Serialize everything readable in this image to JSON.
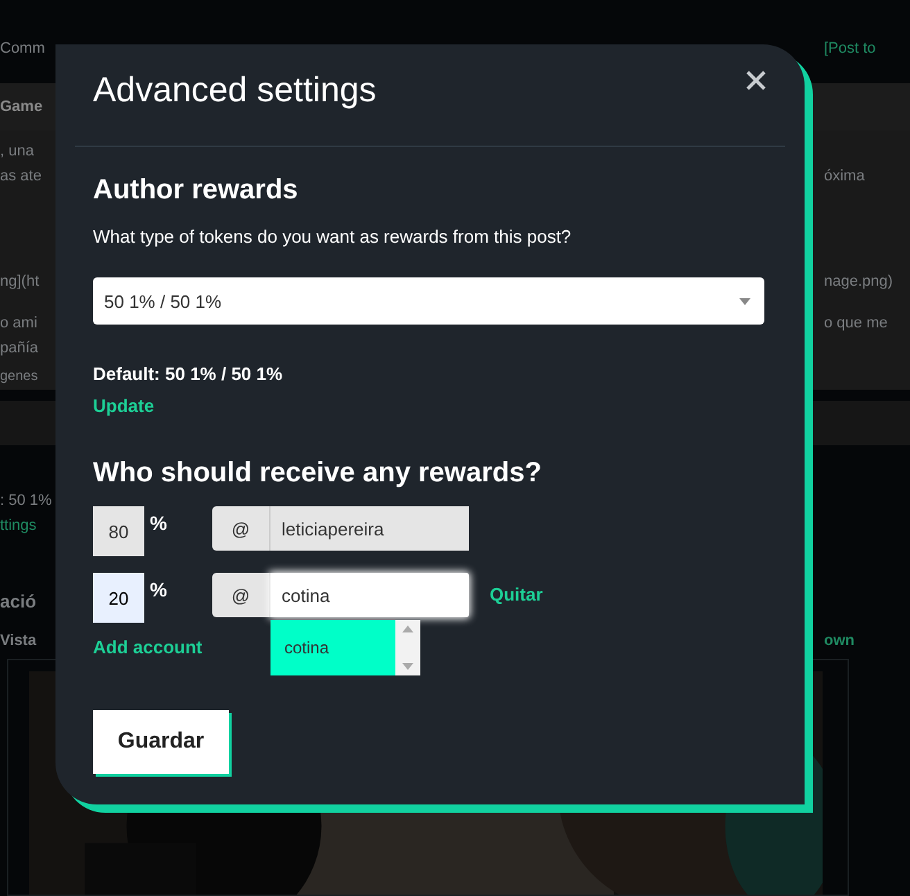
{
  "background_page": {
    "header": {
      "left": "Comm",
      "right": "[Post to"
    },
    "title_bar": {
      "left": "Game"
    },
    "lines": [
      {
        "left": ", una"
      },
      {
        "left": "as ate",
        "right": "óxima"
      },
      {
        "left": "ng](ht",
        "right": "nage.png)"
      },
      {
        "left": "o ami",
        "right": "o que me"
      },
      {
        "left": "pañía"
      }
    ],
    "note": "genes",
    "summary": ": 50 1%",
    "settings_link": "ttings",
    "section_heading": "ació",
    "preview_label": "Vista",
    "preview_link": "own"
  },
  "modal": {
    "title": "Advanced settings",
    "author_rewards": {
      "heading": "Author rewards",
      "question": "What type of tokens do you want as rewards from this post?",
      "select": {
        "value": "50 1% / 50 1%"
      },
      "default_text": "Default: 50 1% / 50 1%",
      "update_link": "Update"
    },
    "beneficiaries": {
      "heading": "Who should receive any rewards?",
      "rows": [
        {
          "percent": "80",
          "unit": "%",
          "prefix": "@",
          "account": "leticiapereira",
          "disabled": true,
          "focused": false
        },
        {
          "percent": "20",
          "unit": "%",
          "prefix": "@",
          "account": "cotina",
          "disabled": false,
          "focused": true,
          "remove_link": "Quitar",
          "suggestions": [
            {
              "label": "cotina",
              "selected": true
            }
          ]
        }
      ],
      "add_link": "Add account"
    },
    "save_button": "Guardar"
  }
}
